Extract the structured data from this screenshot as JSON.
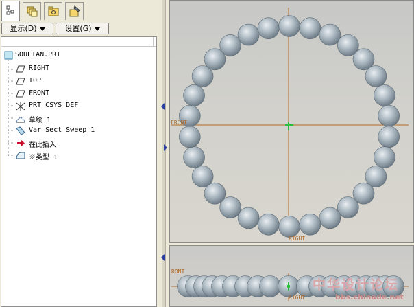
{
  "tabs": [
    {
      "name": "model-tree-tab",
      "icon": "model-tree-icon",
      "active": true
    },
    {
      "name": "layers-tab",
      "icon": "layers-icon",
      "active": false
    },
    {
      "name": "folder-browser-tab",
      "icon": "folder-browser-icon",
      "active": false
    },
    {
      "name": "favorites-tab",
      "icon": "favorites-folder-icon",
      "active": false
    }
  ],
  "toolbar": {
    "display_label": "显示(D)",
    "settings_label": "设置(G)"
  },
  "tree": {
    "root": {
      "label": "SOULIAN.PRT",
      "icon": "part-icon"
    },
    "items": [
      {
        "label": "RIGHT",
        "icon": "datum-plane-icon"
      },
      {
        "label": "TOP",
        "icon": "datum-plane-icon"
      },
      {
        "label": "FRONT",
        "icon": "datum-plane-icon"
      },
      {
        "label": "PRT_CSYS_DEF",
        "icon": "coordinate-system-icon"
      },
      {
        "label": "草绘 1",
        "icon": "sketch-icon"
      },
      {
        "label": "Var Sect Sweep 1",
        "icon": "sweep-feature-icon"
      },
      {
        "label": "在此插入",
        "icon": "insert-here-arrow-icon"
      },
      {
        "label": "※类型 1",
        "icon": "pattern-icon"
      }
    ]
  },
  "viewport": {
    "top_labels": {
      "front": "FRONT",
      "right": "RIGHT"
    },
    "bottom_labels": {
      "front": "RONT",
      "right": "RIGHT"
    },
    "sphere_color": "#9aa9b3",
    "datum_color": "#b06a2a",
    "csys_color": "#2fbf3f"
  },
  "watermark": {
    "chinese": "中华设计论坛",
    "url": "bbs.chinade.net"
  }
}
